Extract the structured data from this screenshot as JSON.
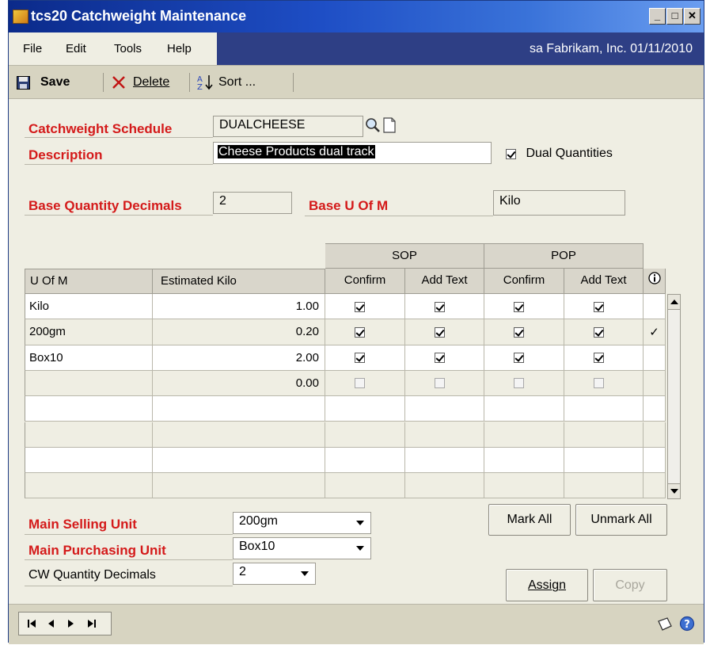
{
  "window": {
    "title": "tcs20 Catchweight Maintenance"
  },
  "menu": {
    "items": [
      "File",
      "Edit",
      "Tools",
      "Help"
    ],
    "user_info": "sa  Fabrikam, Inc.  01/11/2010"
  },
  "toolbar": {
    "save": "Save",
    "delete": "Delete",
    "sort": "Sort ..."
  },
  "form": {
    "schedule_label": "Catchweight Schedule",
    "schedule_value": "DUALCHEESE",
    "description_label": "Description",
    "description_value": "Cheese Products dual track",
    "dual_quantities_label": "Dual Quantities",
    "dual_quantities_checked": true,
    "base_qty_decimals_label": "Base Quantity Decimals",
    "base_qty_decimals_value": "2",
    "base_uom_label": "Base U Of M",
    "base_uom_value": "Kilo"
  },
  "grid": {
    "group_headers": [
      "SOP",
      "POP"
    ],
    "headers": [
      "U Of M",
      "Estimated Kilo",
      "Confirm",
      "Add Text",
      "Confirm",
      "Add Text"
    ],
    "rows": [
      {
        "uom": "Kilo",
        "est": "1.00",
        "checks": [
          true,
          true,
          true,
          true
        ],
        "mark": ""
      },
      {
        "uom": "200gm",
        "est": "0.20",
        "checks": [
          true,
          true,
          true,
          true
        ],
        "mark": "✓"
      },
      {
        "uom": "Box10",
        "est": "2.00",
        "checks": [
          true,
          true,
          true,
          true
        ],
        "mark": ""
      },
      {
        "uom": "",
        "est": "0.00",
        "checks": [
          false,
          false,
          false,
          false
        ],
        "mark": ""
      },
      {
        "uom": "",
        "est": "",
        "checks": null,
        "mark": ""
      },
      {
        "uom": "",
        "est": "",
        "checks": null,
        "mark": ""
      },
      {
        "uom": "",
        "est": "",
        "checks": null,
        "mark": ""
      },
      {
        "uom": "",
        "est": "",
        "checks": null,
        "mark": ""
      }
    ]
  },
  "bottom": {
    "main_selling_label": "Main Selling Unit",
    "main_selling_value": "200gm",
    "main_purchasing_label": "Main Purchasing Unit",
    "main_purchasing_value": "Box10",
    "cw_qty_decimals_label": "CW Quantity Decimals",
    "cw_qty_decimals_value": "2",
    "mark_all": "Mark All",
    "unmark_all": "Unmark All",
    "assign": "Assign",
    "copy": "Copy"
  }
}
